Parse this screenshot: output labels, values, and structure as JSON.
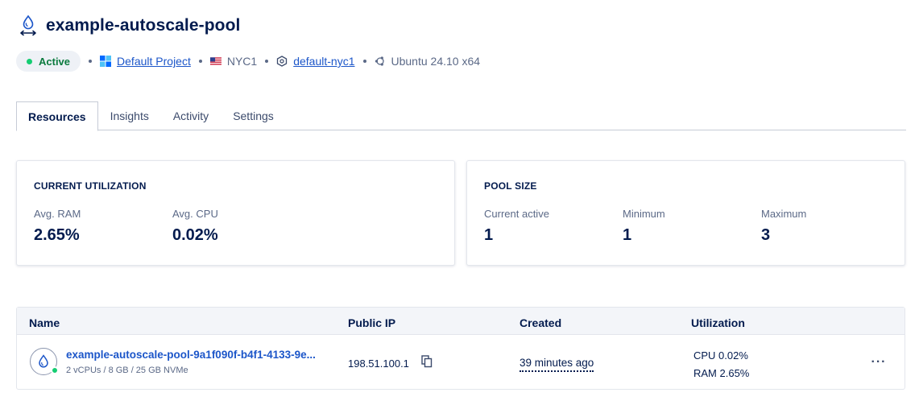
{
  "header": {
    "title": "example-autoscale-pool",
    "icon": "autoscale-pool-icon"
  },
  "meta": {
    "status": "Active",
    "status_color": "#15cd72",
    "project": "Default Project",
    "region": "NYC1",
    "vpc": "default-nyc1",
    "image": "Ubuntu 24.10 x64"
  },
  "tabs": [
    {
      "label": "Resources",
      "active": true
    },
    {
      "label": "Insights",
      "active": false
    },
    {
      "label": "Activity",
      "active": false
    },
    {
      "label": "Settings",
      "active": false
    }
  ],
  "utilization": {
    "title": "CURRENT UTILIZATION",
    "ram_label": "Avg. RAM",
    "ram_value": "2.65%",
    "cpu_label": "Avg. CPU",
    "cpu_value": "0.02%"
  },
  "pool_size": {
    "title": "POOL SIZE",
    "current_label": "Current active",
    "current_value": "1",
    "min_label": "Minimum",
    "min_value": "1",
    "max_label": "Maximum",
    "max_value": "3"
  },
  "table": {
    "columns": [
      "Name",
      "Public IP",
      "Created",
      "Utilization"
    ],
    "rows": [
      {
        "name": "example-autoscale-pool-9a1f090f-b4f1-4133-9e...",
        "specs": "2 vCPUs / 8 GB / 25 GB NVMe",
        "ip": "198.51.100.1",
        "created": "39 minutes ago",
        "cpu": "CPU 0.02%",
        "ram": "RAM 2.65%",
        "more": "···"
      }
    ]
  },
  "colors": {
    "primary_text": "#031b4e",
    "link": "#1c56c9",
    "secondary_text": "#5b6987",
    "active_green": "#15cd72"
  }
}
